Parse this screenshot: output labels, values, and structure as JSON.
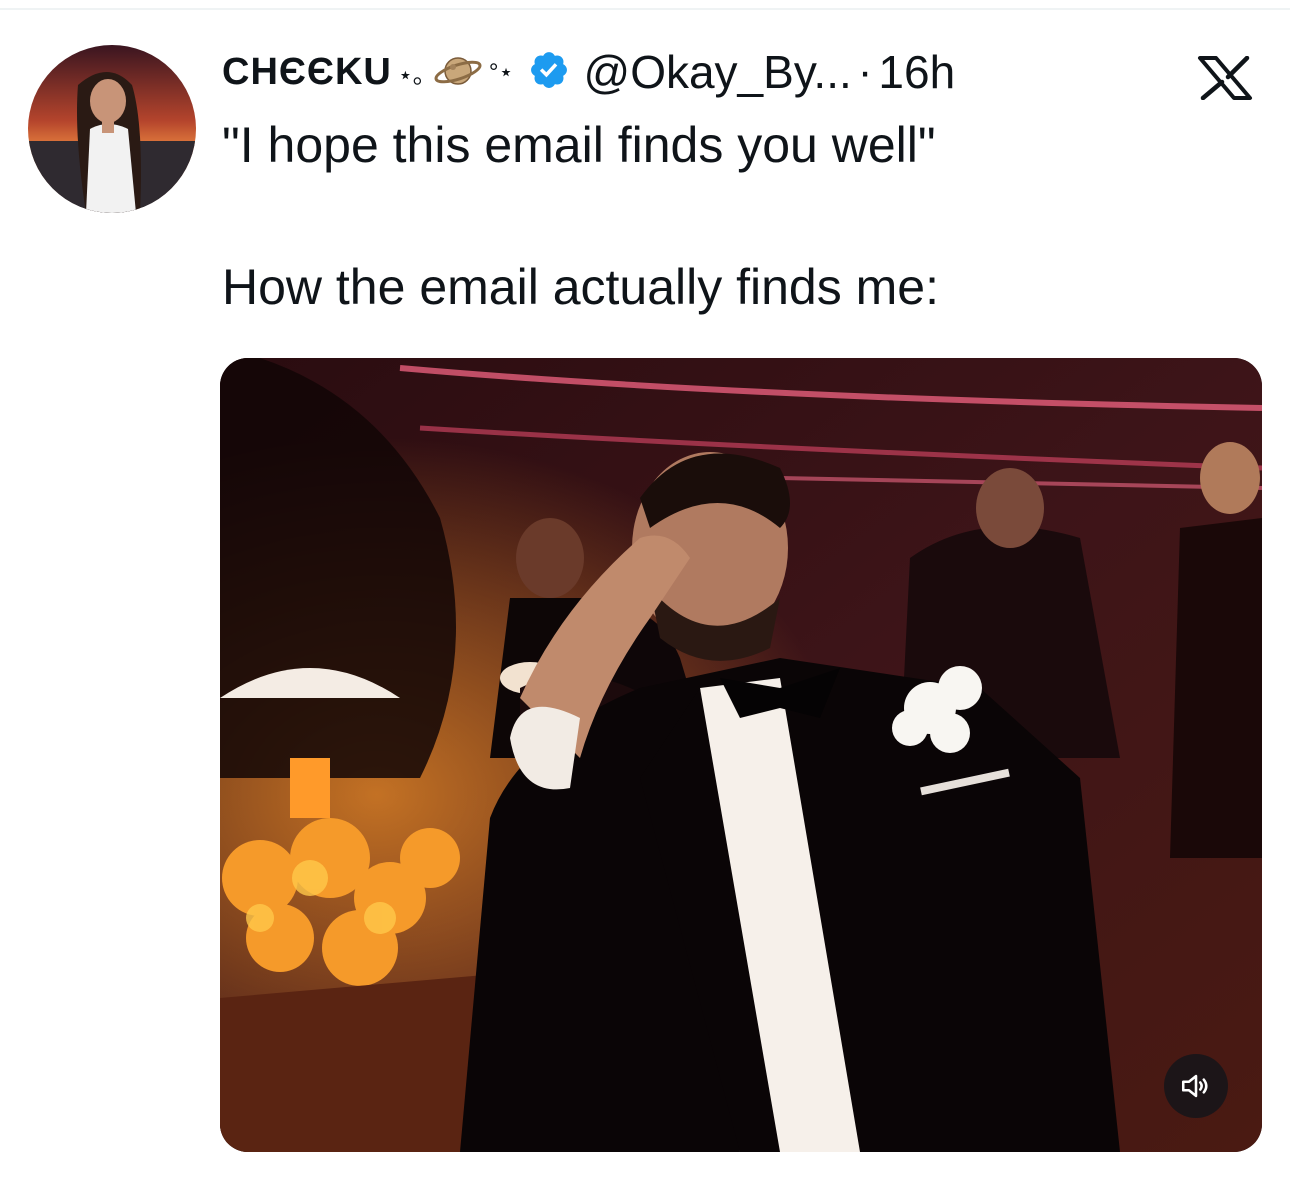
{
  "tweet": {
    "author": {
      "display_name": "CHЄЄKU",
      "name_decoration_left": "⋆｡",
      "name_decoration_right": "°⋆",
      "avatar_icon": "avatar-photo",
      "verified_icon": "verified-badge-icon",
      "handle": "@Okay_By...",
      "separator": "·",
      "time": "16h"
    },
    "platform_icon": "x-logo-icon",
    "text_lines": [
      "\"I hope this email finds you well\"",
      "How the email actually finds me:"
    ],
    "media": {
      "type": "video",
      "sound_icon": "speaker-icon"
    }
  },
  "colors": {
    "text": "#0f1419",
    "verified_badge": "#1d9bf0",
    "divider": "#eff3f4"
  }
}
